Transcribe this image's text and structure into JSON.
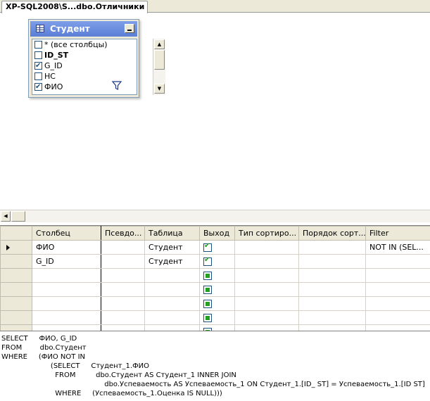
{
  "tab": {
    "title": "XP-SQL2008\\S...dbo.Отличники"
  },
  "table_box": {
    "title": "Студент",
    "columns": [
      {
        "label": "* (все столбцы)",
        "checked": false,
        "bold": false
      },
      {
        "label": "ID_ST",
        "checked": false,
        "bold": true
      },
      {
        "label": "G_ID",
        "checked": true,
        "bold": false
      },
      {
        "label": "НС",
        "checked": false,
        "bold": false
      },
      {
        "label": "ФИО",
        "checked": true,
        "bold": false
      }
    ]
  },
  "grid": {
    "headers": [
      "Столбец",
      "Псевдо...",
      "Таблица",
      "Выход",
      "Тип сортиро...",
      "Порядок сорт...",
      "Filter"
    ],
    "rows": [
      {
        "column": "ФИО",
        "alias": "",
        "table": "Студент",
        "output": "checked",
        "sort_type": "",
        "sort_order": "",
        "filter": "NOT IN (SEL...",
        "current": true
      },
      {
        "column": "G_ID",
        "alias": "",
        "table": "Студент",
        "output": "checked",
        "sort_type": "",
        "sort_order": "",
        "filter": "",
        "current": false
      },
      {
        "column": "",
        "alias": "",
        "table": "",
        "output": "empty",
        "sort_type": "",
        "sort_order": "",
        "filter": "",
        "current": false
      },
      {
        "column": "",
        "alias": "",
        "table": "",
        "output": "empty",
        "sort_type": "",
        "sort_order": "",
        "filter": "",
        "current": false
      },
      {
        "column": "",
        "alias": "",
        "table": "",
        "output": "empty",
        "sort_type": "",
        "sort_order": "",
        "filter": "",
        "current": false
      },
      {
        "column": "",
        "alias": "",
        "table": "",
        "output": "empty",
        "sort_type": "",
        "sort_order": "",
        "filter": "",
        "current": false
      },
      {
        "column": "",
        "alias": "",
        "table": "",
        "output": "empty",
        "sort_type": "",
        "sort_order": "",
        "filter": "",
        "current": false
      }
    ]
  },
  "sql": {
    "lines": [
      "SELECT     ФИО, G_ID",
      "FROM        dbo.Студент",
      "WHERE     (ФИО NOT IN",
      "                      (SELECT     Студент_1.ФИО",
      "                        FROM         dbo.Студент AS Студент_1 INNER JOIN",
      "                                              dbo.Успеваемость AS Успеваемость_1 ON Студент_1.[ID_ ST] = Успеваемость_1.[ID ST]",
      "                        WHERE     (Успеваемость_1.Оценка IS NULL)))"
    ]
  },
  "colors": {
    "title_bar": "#6a8ddf",
    "check_green": "#21a121",
    "chrome": "#ece9d8"
  }
}
